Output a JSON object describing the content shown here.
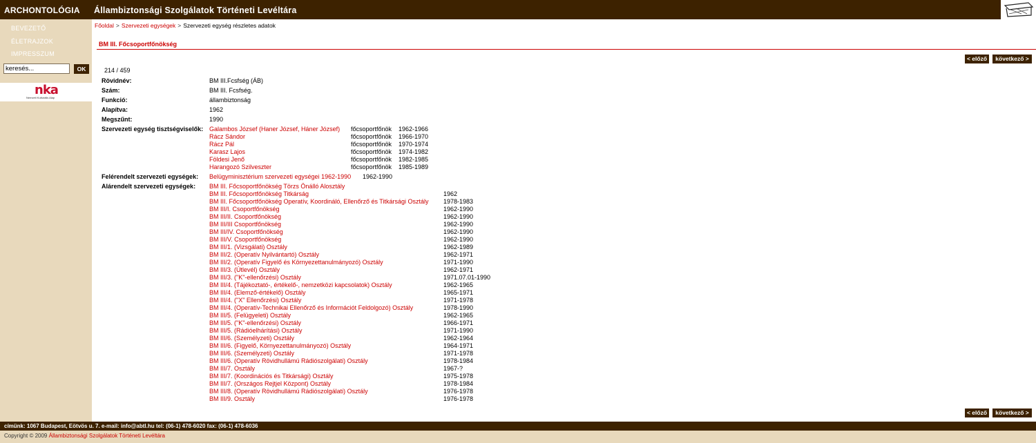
{
  "header": {
    "brand": "ARCHONTOLÓGIA",
    "title": "Állambiztonsági Szolgálatok Történeti Levéltára"
  },
  "sidebar": {
    "items": [
      {
        "label": "BEVEZETŐ"
      },
      {
        "label": "ÉLETRAJZOK"
      },
      {
        "label": "IMPRESSZUM"
      }
    ],
    "search": {
      "value": "keresés...",
      "button": "OK"
    },
    "sponsor": {
      "logo": "nka",
      "caption": "Nemzeti Kulturális Alap"
    }
  },
  "breadcrumb": [
    {
      "label": "Főoldal",
      "link": true
    },
    {
      "label": "Szervezeti egységek",
      "link": true
    },
    {
      "label": "Szervezeti egység részletes adatok",
      "link": false
    }
  ],
  "breadcrumb_sep": ">",
  "page_title": "BM III. Főcsoportfőnökség",
  "nav": {
    "prev": "< előző",
    "next": "következő >"
  },
  "counter": "214 / 459",
  "details": [
    {
      "label": "Rövidnév:",
      "value": "BM III.Fcsfség (ÁB)"
    },
    {
      "label": "Szám:",
      "value": "BM III. Fcsfség."
    },
    {
      "label": "Funkció:",
      "value": "állambiztonság"
    },
    {
      "label": "Alapítva:",
      "value": "1962"
    },
    {
      "label": "Megszűnt:",
      "value": "1990"
    }
  ],
  "officials_label": "Szervezeti egység tisztségviselők:",
  "officials": [
    {
      "name": "Galambos József (Haner József, Háner József)",
      "role": "főcsoportfőnök",
      "years": "1962-1966"
    },
    {
      "name": "Rácz Sándor",
      "role": "főcsoportfőnök",
      "years": "1966-1970"
    },
    {
      "name": "Rácz Pál",
      "role": "főcsoportfőnök",
      "years": "1970-1974"
    },
    {
      "name": "Karasz Lajos",
      "role": "főcsoportfőnök",
      "years": "1974-1982"
    },
    {
      "name": "Földesi Jenő",
      "role": "főcsoportfőnök",
      "years": "1982-1985"
    },
    {
      "name": "Harangozó Szilveszter",
      "role": "főcsoportfőnök",
      "years": "1985-1989"
    }
  ],
  "superior_label": "Felérendelt szervezeti egységek:",
  "superior": {
    "name": "Belügyminisztérium szervezeti egységei 1962-1990",
    "years": "1962-1990"
  },
  "subordinate_label": "Alárendelt szervezeti egységek:",
  "subordinates": [
    {
      "name": "BM III. Főcsoportfőnökség Törzs Önálló Alosztály",
      "years": ""
    },
    {
      "name": "BM III. Főcsoportfőnökség Titkárság",
      "years": "1962"
    },
    {
      "name": "BM III. Főcsoportfőnökség Operatív, Koordináló, Ellenőrző és Titkársági Osztály",
      "years": "1978-1983"
    },
    {
      "name": "BM III/I. Csoportfőnökség",
      "years": "1962-1990"
    },
    {
      "name": "BM III/II. Csoportfőnökség",
      "years": "1962-1990"
    },
    {
      "name": "BM III/III Csoportfőnökség",
      "years": "1962-1990"
    },
    {
      "name": "BM III/IV. Csoportfőnökség",
      "years": "1962-1990"
    },
    {
      "name": "BM III/V. Csoportfőnökség",
      "years": "1962-1990"
    },
    {
      "name": "BM III/1. (Vizsgálati) Osztály",
      "years": "1962-1989"
    },
    {
      "name": "BM III/2. (Operatív Nyilvántartó) Osztály",
      "years": "1962-1971"
    },
    {
      "name": "BM III/2. (Operatív Figyelő és Környezettanulmányozó) Osztály",
      "years": "1971-1990"
    },
    {
      "name": "BM III/3. (Útlevél) Osztály",
      "years": "1962-1971"
    },
    {
      "name": "BM III/3. (\"K\"-ellenőrzési) Osztály",
      "years": "1971.07.01-1990"
    },
    {
      "name": "BM III/4. (Tájékoztató-, értékelő-, nemzetközi kapcsolatok) Osztály",
      "years": "1962-1965"
    },
    {
      "name": "BM III/4. (Elemző-értékelő) Osztály",
      "years": "1965-1971"
    },
    {
      "name": "BM III/4. (\"X\" Ellenőrzési) Osztály",
      "years": "1971-1978"
    },
    {
      "name": "BM III/4. (Operatív-Technikai Ellenőrző és Információt Feldolgozó) Osztály",
      "years": "1978-1990"
    },
    {
      "name": "BM III/5. (Felügyeleti) Osztály",
      "years": "1962-1965"
    },
    {
      "name": "BM III/5. (\"K\"-ellenőrzési) Osztály",
      "years": "1966-1971"
    },
    {
      "name": "BM III/5. (Rádióelhárítási) Osztály",
      "years": "1971-1990"
    },
    {
      "name": "BM III/6. (Személyzeti) Osztály",
      "years": "1962-1964"
    },
    {
      "name": "BM III/6. (Figyelő, Környezettanulmányozó) Osztály",
      "years": "1964-1971"
    },
    {
      "name": "BM III/6. (Személyzeti) Osztály",
      "years": "1971-1978"
    },
    {
      "name": "BM III/6. (Operatív Rövidhullámú Rádiószolgálati) Osztály",
      "years": "1978-1984"
    },
    {
      "name": "BM III/7. Osztály",
      "years": "1967-?"
    },
    {
      "name": "BM III/7. (Koordinációs és Titkársági) Osztály",
      "years": "1975-1978"
    },
    {
      "name": "BM III/7. (Országos Rejtjel Központ) Osztály",
      "years": "1978-1984"
    },
    {
      "name": "BM III/8. (Operatív Rövidhullámú Rádiószolgálati) Osztály",
      "years": "1976-1978"
    },
    {
      "name": "BM III/9. Osztály",
      "years": "1976-1978"
    }
  ],
  "footer": {
    "address": "címünk: 1067 Budapest, Eötvös u. 7. e-mail: info@abtl.hu tel: (06-1) 478-6020 fax: (06-1) 478-6036",
    "copyright_prefix": "Copyright © 2009",
    "copyright_link": "Állambiztonsági Szolgálatok Történeti Levéltára"
  },
  "colors": {
    "header_bg": "#3d2200",
    "sidebar_bg": "#e8d9bc",
    "link": "#cc0000"
  }
}
